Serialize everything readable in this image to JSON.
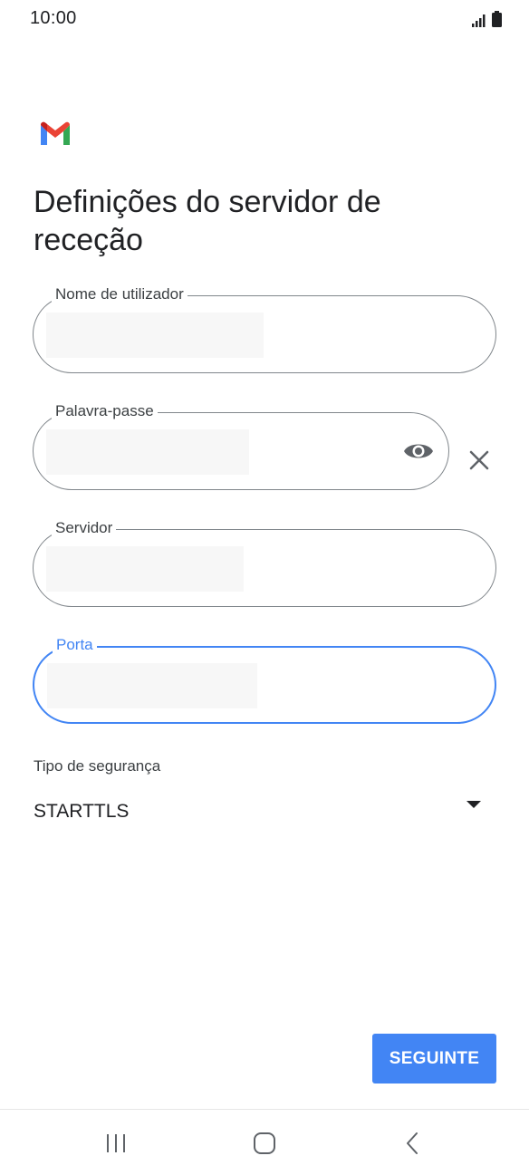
{
  "status_bar": {
    "time": "10:00",
    "icons": [
      "signal-icon",
      "battery-icon"
    ]
  },
  "app": {
    "logo": "gmail-logo-icon"
  },
  "page": {
    "title": "Definições do servidor de receção"
  },
  "form": {
    "username": {
      "label": "Nome de utilizador",
      "value": ""
    },
    "password": {
      "label": "Palavra-passe",
      "value": "",
      "visibility_icon": "eye-icon",
      "clear_icon": "close-icon"
    },
    "server": {
      "label": "Servidor",
      "value": ""
    },
    "port": {
      "label": "Porta",
      "value": "",
      "focused": true
    }
  },
  "security": {
    "label": "Tipo de segurança",
    "selected": "STARTTLS"
  },
  "actions": {
    "next_label": "SEGUINTE"
  },
  "nav_bar": {
    "items": [
      "recent-apps-icon",
      "home-icon",
      "back-icon"
    ]
  },
  "colors": {
    "accent": "#4285f4",
    "outline": "#80868b",
    "text": "#202124"
  }
}
